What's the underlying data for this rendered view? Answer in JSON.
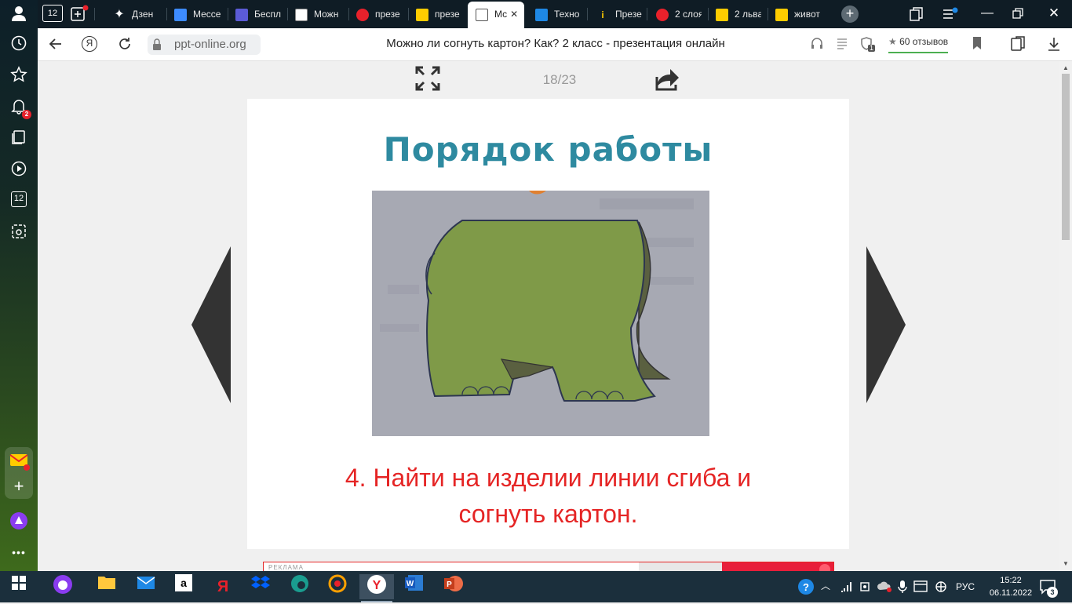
{
  "sidebar": {
    "notifications_badge": "2",
    "calendar_day": "12"
  },
  "tabs": [
    {
      "label": "Дзен",
      "color": "#ffffff"
    },
    {
      "label": "Мессе",
      "color": "#3d8bff"
    },
    {
      "label": "Беспл",
      "color": "#5b5bd6"
    },
    {
      "label": "Можн",
      "color": "#cccccc"
    },
    {
      "label": "презе",
      "color": "#e8212b"
    },
    {
      "label": "презе",
      "color": "#ffcc00"
    },
    {
      "label": "Мс",
      "color": "#555555",
      "active": true
    },
    {
      "label": "Техно",
      "color": "#1e88e5"
    },
    {
      "label": "Презе",
      "color": "#ffcc00"
    },
    {
      "label": "2 слоя",
      "color": "#e8212b"
    },
    {
      "label": "2 льва",
      "color": "#ffcc00"
    },
    {
      "label": "живот",
      "color": "#ffcc00"
    }
  ],
  "topleft": {
    "home_day": "12"
  },
  "address": {
    "url": "ppt-online.org",
    "page_title": "Можно ли согнуть картон? Как? 2 класс - презентация онлайн",
    "reviews": "60 отзывов",
    "protect_count": "1"
  },
  "viewer": {
    "counter": "18/23"
  },
  "slide": {
    "title": "Порядок работы",
    "step_line1": "4. Найти на изделии линии сгиба и",
    "step_line2": "согнуть картон.",
    "title_color": "#2e8aa0",
    "text_color": "#e52525"
  },
  "ad": {
    "label": "РЕКЛАМА"
  },
  "taskbar": {
    "lang": "РУС",
    "time": "15:22",
    "date": "06.11.2022",
    "notif_count": "3"
  }
}
